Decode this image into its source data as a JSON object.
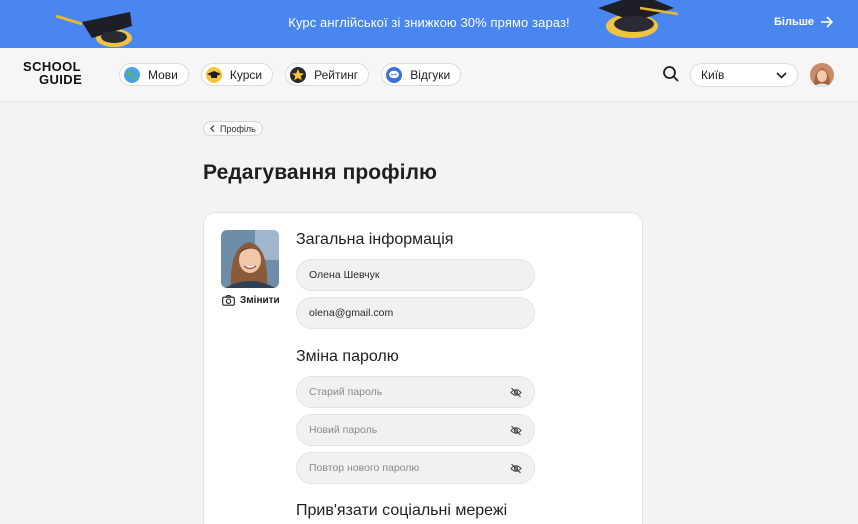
{
  "promo": {
    "text": "Курс англійської зі знижкою 30% прямо зараз!",
    "more_label": "Більше",
    "bg_color": "#4a86f0"
  },
  "header": {
    "logo_line1": "SCHOOL",
    "logo_line2": "GUIDE",
    "nav": [
      {
        "label": "Мови",
        "icon": "globe-icon"
      },
      {
        "label": "Курси",
        "icon": "graduation-cap-icon"
      },
      {
        "label": "Рейтинг",
        "icon": "star-icon"
      },
      {
        "label": "Відгуки",
        "icon": "chat-bubble-icon"
      }
    ],
    "city": "Київ"
  },
  "breadcrumb": {
    "label": "Профіль"
  },
  "page_title": "Редагування профілю",
  "profile": {
    "change_photo_label": "Змінити",
    "general_title": "Загальна інформація",
    "name_value": "Олена Шевчук",
    "email_value": "olena@gmail.com",
    "password_title": "Зміна паролю",
    "old_password_placeholder": "Старий пароль",
    "new_password_placeholder": "Новий пароль",
    "repeat_password_placeholder": "Повтор нового паролю",
    "social_title": "Прив'язати соціальні мережі"
  }
}
